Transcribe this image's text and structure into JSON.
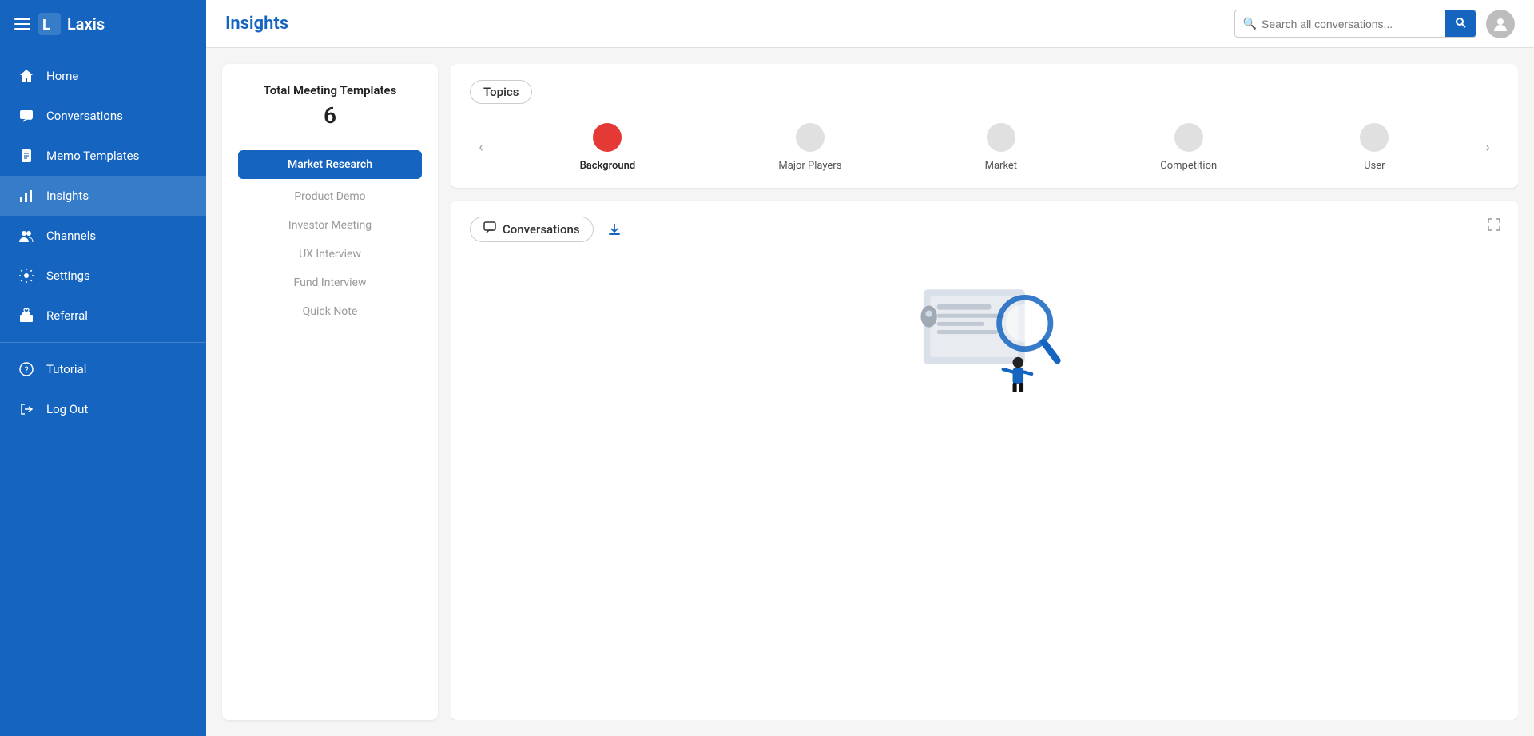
{
  "sidebar": {
    "brand": "Laxis",
    "nav_items": [
      {
        "id": "home",
        "label": "Home",
        "icon": "home"
      },
      {
        "id": "conversations",
        "label": "Conversations",
        "icon": "chat"
      },
      {
        "id": "memo-templates",
        "label": "Memo Templates",
        "icon": "document"
      },
      {
        "id": "insights",
        "label": "Insights",
        "icon": "bar-chart",
        "active": true
      },
      {
        "id": "channels",
        "label": "Channels",
        "icon": "people"
      },
      {
        "id": "settings",
        "label": "Settings",
        "icon": "gear"
      },
      {
        "id": "referral",
        "label": "Referral",
        "icon": "gift"
      }
    ],
    "bottom_items": [
      {
        "id": "tutorial",
        "label": "Tutorial",
        "icon": "question"
      },
      {
        "id": "logout",
        "label": "Log Out",
        "icon": "logout"
      }
    ]
  },
  "topbar": {
    "title": "Insights",
    "search_placeholder": "Search all conversations..."
  },
  "templates_panel": {
    "count_label": "Total Meeting Templates",
    "count": "6",
    "items": [
      {
        "id": "market-research",
        "label": "Market Research",
        "active": true
      },
      {
        "id": "product-demo",
        "label": "Product Demo",
        "active": false
      },
      {
        "id": "investor-meeting",
        "label": "Investor Meeting",
        "active": false
      },
      {
        "id": "ux-interview",
        "label": "UX Interview",
        "active": false
      },
      {
        "id": "fund-interview",
        "label": "Fund Interview",
        "active": false
      },
      {
        "id": "quick-note",
        "label": "Quick Note",
        "active": false
      }
    ]
  },
  "topics_section": {
    "title": "Topics",
    "items": [
      {
        "id": "background",
        "label": "Background",
        "active": true
      },
      {
        "id": "major-players",
        "label": "Major Players",
        "active": false
      },
      {
        "id": "market",
        "label": "Market",
        "active": false
      },
      {
        "id": "competition",
        "label": "Competition",
        "active": false
      },
      {
        "id": "user",
        "label": "User",
        "active": false
      }
    ]
  },
  "conversations_section": {
    "title": "Conversations",
    "download_label": "Download",
    "expand_label": "Expand"
  }
}
